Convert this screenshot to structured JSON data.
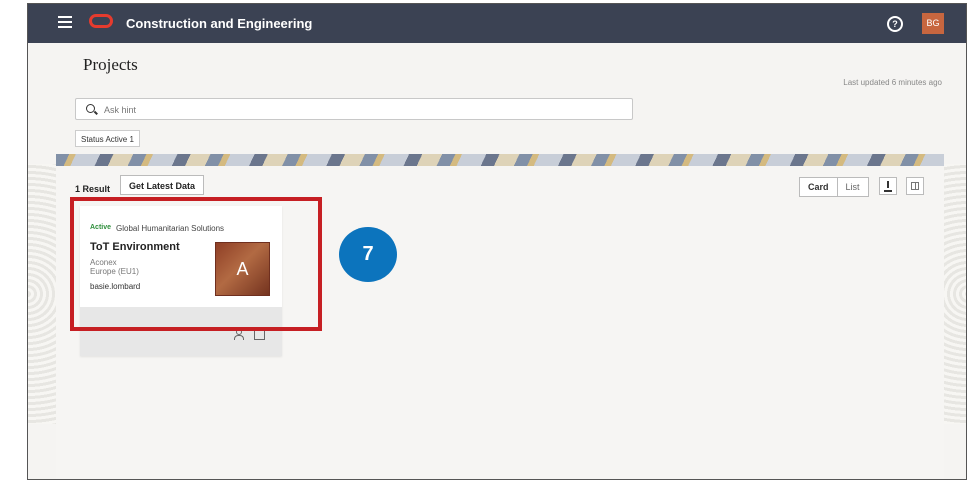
{
  "app": {
    "title": "Construction and Engineering",
    "user_initials": "BG"
  },
  "page": {
    "title": "Projects",
    "updated": "Last updated 6 minutes ago"
  },
  "search": {
    "placeholder": "Ask hint"
  },
  "filters": [
    "Status Active 1"
  ],
  "results": {
    "count": "1 Result",
    "latest_data_label": "Get Latest Data"
  },
  "view": {
    "card_label": "Card",
    "list_label": "List"
  },
  "project": {
    "status": "Active",
    "organization": "Global Humanitarian Solutions",
    "name": "ToT Environment",
    "platform": "Aconex",
    "region": "Europe (EU1)",
    "user": "basie.lombard",
    "avatar_letter": "A"
  },
  "callout": {
    "step": "7"
  },
  "icons": [
    "hamburger-menu-icon",
    "oracle-logo-icon",
    "help-icon",
    "search-icon",
    "download-icon",
    "columns-icon",
    "person-icon",
    "open-in-new-icon"
  ],
  "colors": {
    "topbar": "#3b4253",
    "highlight": "#c61f23",
    "badge": "#0c74bd",
    "avatar": "#c7663f"
  }
}
